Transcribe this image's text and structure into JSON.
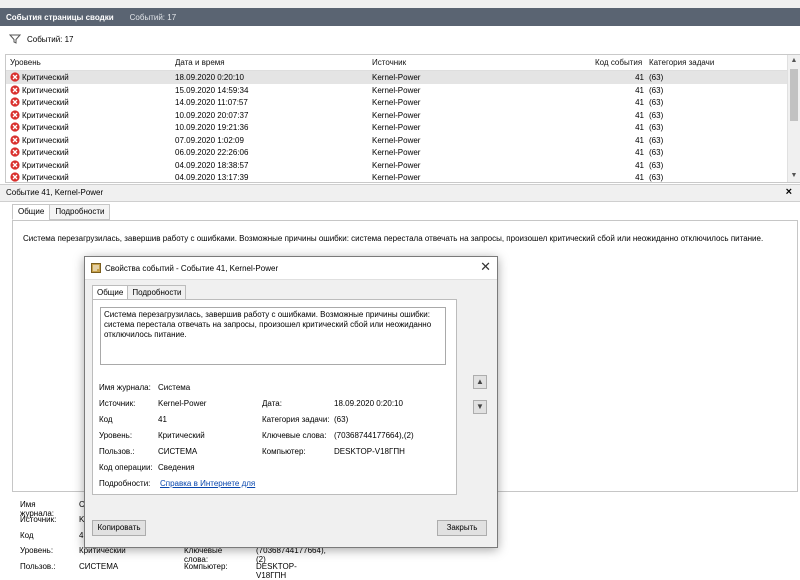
{
  "header": {
    "title": "События страницы сводки",
    "count": "Событий: 17"
  },
  "filter": {
    "count": "Событий: 17",
    "icon": "filter-funnel-icon"
  },
  "table": {
    "columns": [
      "Уровень",
      "Дата и время",
      "Источник",
      "Код события",
      "Категория задачи"
    ],
    "rows": [
      {
        "level": "Критический",
        "date": "18.09.2020 0:20:10",
        "source": "Kernel-Power",
        "code": "41",
        "category": "(63)"
      },
      {
        "level": "Критический",
        "date": "15.09.2020 14:59:34",
        "source": "Kernel-Power",
        "code": "41",
        "category": "(63)"
      },
      {
        "level": "Критический",
        "date": "14.09.2020 11:07:57",
        "source": "Kernel-Power",
        "code": "41",
        "category": "(63)"
      },
      {
        "level": "Критический",
        "date": "10.09.2020 20:07:37",
        "source": "Kernel-Power",
        "code": "41",
        "category": "(63)"
      },
      {
        "level": "Критический",
        "date": "10.09.2020 19:21:36",
        "source": "Kernel-Power",
        "code": "41",
        "category": "(63)"
      },
      {
        "level": "Критический",
        "date": "07.09.2020 1:02:09",
        "source": "Kernel-Power",
        "code": "41",
        "category": "(63)"
      },
      {
        "level": "Критический",
        "date": "06.09.2020 22:26:06",
        "source": "Kernel-Power",
        "code": "41",
        "category": "(63)"
      },
      {
        "level": "Критический",
        "date": "04.09.2020 18:38:57",
        "source": "Kernel-Power",
        "code": "41",
        "category": "(63)"
      },
      {
        "level": "Критический",
        "date": "04.09.2020 13:17:39",
        "source": "Kernel-Power",
        "code": "41",
        "category": "(63)"
      }
    ]
  },
  "details": {
    "header": "Событие 41, Kernel-Power",
    "tabs": [
      "Общие",
      "Подробности"
    ],
    "description": "Система перезагрузилась, завершив работу с ошибками. Возможные причины ошибки: система перестала отвечать на запросы, произошел критический сбой или неожиданно отключилось питание.",
    "bottom_labels": [
      {
        "label": "Имя журнала:",
        "value": "С"
      },
      {
        "label": "Источник:",
        "value": "K"
      },
      {
        "label": "Код",
        "value": "4"
      },
      {
        "label": "Уровень:",
        "value": "Критический"
      },
      {
        "label": "Пользов.:",
        "value": "СИСТЕМА"
      }
    ],
    "bottom_right": [
      {
        "label": "Ключевые слова:",
        "value": "(70368744177664),(2)"
      },
      {
        "label": "Компьютер:",
        "value": "DESKTOP-V18ГПН"
      }
    ]
  },
  "dialog": {
    "title": "Свойства событий - Событие 41, Kernel-Power",
    "tabs": [
      "Общие",
      "Подробности"
    ],
    "description": "Система перезагрузилась, завершив работу с ошибками. Возможные причины ошибки: система перестала отвечать на запросы, произошел критический сбой или неожиданно отключилось питание.",
    "fields": {
      "journal_label": "Имя журнала:",
      "journal": "Система",
      "source_label": "Источник:",
      "source": "Kernel-Power",
      "code_label": "Код",
      "code": "41",
      "level_label": "Уровень:",
      "level": "Критический",
      "user_label": "Пользов.:",
      "user": "СИСТЕМА",
      "opcode_label": "Код операции:",
      "opcode": "Сведения",
      "more_label": "Подробности:",
      "more_link": "Справка в Интернете для",
      "date_label": "Дата:",
      "date": "18.09.2020 0:20:10",
      "category_label": "Категория задачи:",
      "category": "(63)",
      "keywords_label": "Ключевые слова:",
      "keywords": "(70368744177664),(2)",
      "computer_label": "Компьютер:",
      "computer": "DESKTOP-V18ГПН"
    },
    "copy_button": "Копировать",
    "close_button": "Закрыть"
  },
  "colors": {
    "title_bar": "#5a6472",
    "critical": "#d9302d",
    "link": "#0645ad",
    "selection": "#e4e4e4"
  }
}
